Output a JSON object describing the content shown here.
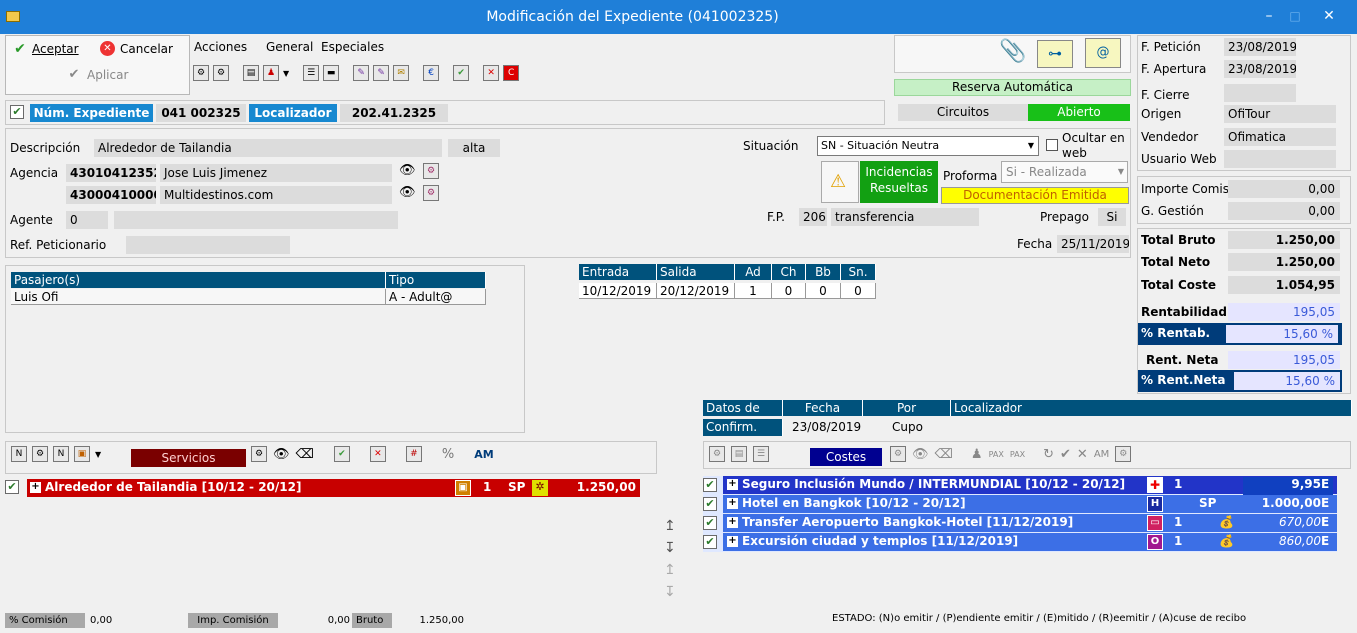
{
  "window": {
    "title": "Modificación del Expediente (041002325)",
    "min": "–",
    "max": "□",
    "close": "✕"
  },
  "actions": {
    "accept": "Aceptar",
    "cancel": "Cancelar",
    "apply": "Aplicar"
  },
  "menu": [
    "Acciones",
    "General",
    "Especiales"
  ],
  "expediente": {
    "num_label": "Núm. Expediente",
    "num_value": "041 002325",
    "loc_label": "Localizador",
    "loc_value": "202.41.2325"
  },
  "reserva": {
    "auto_label": "Reserva Automática",
    "circuitos": "Circuitos",
    "estado": "Abierto"
  },
  "fechas": {
    "peticion_label": "F. Petición",
    "peticion": "23/08/2019",
    "apertura_label": "F. Apertura",
    "apertura": "23/08/2019",
    "cierre_label": "F. Cierre",
    "cierre": "",
    "origen_label": "Origen",
    "origen": "OfiTour",
    "vendedor_label": "Vendedor",
    "vendedor": "Ofimatica",
    "usuario_label": "Usuario Web",
    "usuario": ""
  },
  "form": {
    "descripcion_label": "Descripción",
    "descripcion": "Alrededor de Tailandia",
    "alta": "alta",
    "agencia_label": "Agencia",
    "agencia1_code": "43010412352",
    "agencia1_name": "Jose Luis Jimenez",
    "agencia2_code": "43000410000",
    "agencia2_name": "Multidestinos.com",
    "agente_label": "Agente",
    "agente": "0",
    "refpet_label": "Ref. Peticionario",
    "situacion_label": "Situación",
    "situacion": "SN - Situación Neutra",
    "ocultar": "Ocultar en web",
    "incidencias": "Incidencias Resueltas",
    "proforma_label": "Proforma",
    "proforma": "Si - Realizada",
    "documentacion": "Documentación Emitida",
    "fp_label": "F.P.",
    "fp_code": "206",
    "fp_desc": "transferencia",
    "prepago_label": "Prepago",
    "prepago": "Si",
    "fecha_label": "Fecha",
    "fecha": "25/11/2019"
  },
  "importes": {
    "comis_label": "Importe Comis",
    "comis": "0,00",
    "gestion_label": "G. Gestión",
    "gestion": "0,00",
    "bruto_label": "Total Bruto",
    "bruto": "1.250,00",
    "neto_label": "Total Neto",
    "neto": "1.250,00",
    "coste_label": "Total Coste",
    "coste": "1.054,95",
    "rent_label": "Rentabilidad",
    "rent": "195,05",
    "pctrent_label": "% Rentab.",
    "pctrent": "15,60 %",
    "rentneta_label": "Rent. Neta",
    "rentneta": "195,05",
    "pctneta_label": "% Rent.Neta",
    "pctneta": "15,60 %"
  },
  "pasajeros": {
    "headers": [
      "Pasajero(s)",
      "Tipo"
    ],
    "rows": [
      [
        "Luis Ofi",
        "A - Adult@"
      ]
    ]
  },
  "estancia": {
    "headers": [
      "Entrada",
      "Salida",
      "Ad",
      "Ch",
      "Bb",
      "Sn."
    ],
    "row": [
      "10/12/2019",
      "20/12/2019",
      "1",
      "0",
      "0",
      "0"
    ]
  },
  "confirm": {
    "headers": [
      "Datos de",
      "Fecha",
      "Por",
      "Localizador"
    ],
    "row": [
      "Confirm.",
      "23/08/2019",
      "Cupo",
      ""
    ]
  },
  "servicios": {
    "label": "Servicios",
    "row": {
      "name": "Alrededor de Tailandia [10/12 - 20/12]",
      "qty": "1",
      "sp": "SP",
      "amount": "1.250,00"
    }
  },
  "costes": {
    "label": "Costes",
    "rows": [
      {
        "name": "Seguro Inclusión Mundo / INTERMUNDIAL [10/12 - 20/12]",
        "qty": "1",
        "sp": "",
        "amount": "9,95",
        "st": "E",
        "icon": "+"
      },
      {
        "name": "Hotel en Bangkok [10/12 - 20/12]",
        "qty": "",
        "sp": "SP",
        "amount": "1.000,00",
        "st": "E",
        "icon": "H"
      },
      {
        "name": "Transfer Aeropuerto Bangkok-Hotel [11/12/2019]",
        "qty": "1",
        "sp": "",
        "amount": "670,00",
        "st": "E",
        "icon": "▭"
      },
      {
        "name": "Excursión ciudad y templos [11/12/2019]",
        "qty": "1",
        "sp": "",
        "amount": "860,00",
        "st": "E",
        "icon": "O"
      }
    ]
  },
  "footer": {
    "comision_label": "% Comisión",
    "comision": "0,00",
    "impcom_label": "Imp. Comisión",
    "impcom": "0,00",
    "bruto_label": "Bruto",
    "bruto": "1.250,00",
    "estado": "ESTADO: (N)o emitir / (P)endiente emitir / (E)mitido / (R)eemitir / (A)cuse de recibo"
  },
  "colors": {
    "titlebar": "#1f7fd8",
    "blue_label": "#1788d0",
    "green": "#3ad13a",
    "red_row": "#c80000",
    "blue_row": "#3c6fe6",
    "dark_header": "#00527c",
    "yellow": "#ffff00"
  }
}
